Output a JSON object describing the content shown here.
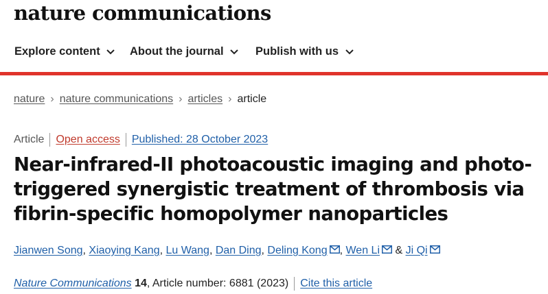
{
  "brand": "nature communications",
  "nav": [
    {
      "label": "Explore content"
    },
    {
      "label": "About the journal"
    },
    {
      "label": "Publish with us"
    }
  ],
  "breadcrumbs": {
    "items": [
      "nature",
      "nature communications",
      "articles"
    ],
    "current": "article"
  },
  "article": {
    "type": "Article",
    "access": "Open access",
    "published": "Published: 28 October 2023",
    "title_lines": [
      "Near-infrared-II photoacoustic imaging and photo-",
      "triggered synergistic treatment of thrombosis via",
      "fibrin-specific homopolymer nanoparticles"
    ],
    "authors": [
      {
        "name": "Jianwen Song"
      },
      {
        "name": "Xiaoying Kang"
      },
      {
        "name": "Lu Wang"
      },
      {
        "name": "Dan Ding"
      },
      {
        "name": "Deling Kong"
      },
      {
        "name": "Wen Li"
      },
      {
        "name": "Ji Qi"
      }
    ],
    "author_sep": ", ",
    "author_amp": " & ",
    "journal": "Nature Communications",
    "volume": "14",
    "article_number": ", Article number: 6881 (2023)",
    "cite_label": "Cite this article"
  },
  "colors": {
    "accent_bar": "#e0332b",
    "link": "#1f5fa8",
    "open_access": "#c0392b"
  }
}
